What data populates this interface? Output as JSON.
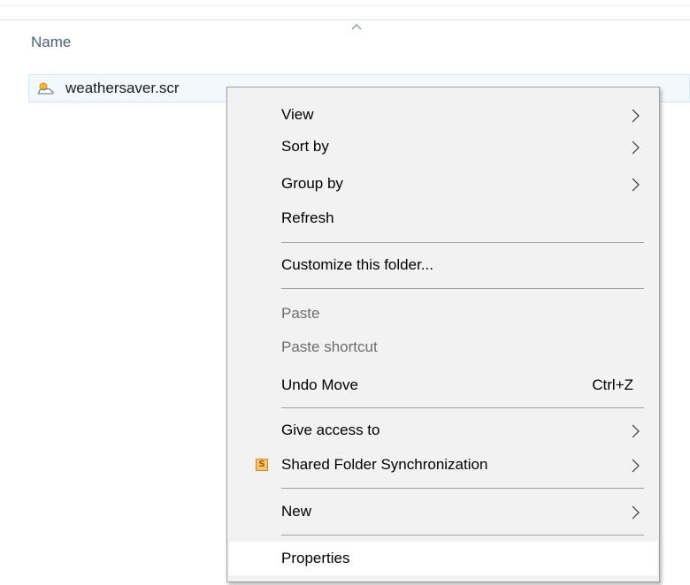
{
  "column_header": {
    "name_label": "Name",
    "sort_icon": "sort-ascending-chevron-icon"
  },
  "file": {
    "name": "weathersaver.scr",
    "icon": "screensaver-file-icon"
  },
  "context_menu": {
    "items": [
      {
        "label": "View",
        "submenu": true
      },
      {
        "label": "Sort by",
        "submenu": true
      },
      {
        "label": "Group by",
        "submenu": true
      },
      {
        "label": "Refresh"
      },
      {
        "label": "Customize this folder..."
      },
      {
        "label": "Paste",
        "disabled": true
      },
      {
        "label": "Paste shortcut",
        "disabled": true
      },
      {
        "label": "Undo Move",
        "shortcut": "Ctrl+Z"
      },
      {
        "label": "Give access to",
        "submenu": true
      },
      {
        "label": "Shared Folder Synchronization",
        "submenu": true,
        "icon": "sync-app-icon",
        "icon_glyph": "S"
      },
      {
        "label": "New",
        "submenu": true
      },
      {
        "label": "Properties",
        "highlighted": true
      }
    ]
  },
  "colors": {
    "menu_background": "#f2f2f2",
    "menu_border": "#a0a0a0",
    "selection_background": "#f3f8fd",
    "selection_border": "#cde8ff",
    "header_text": "#4c607a",
    "disabled_text": "#6d6d6d"
  }
}
